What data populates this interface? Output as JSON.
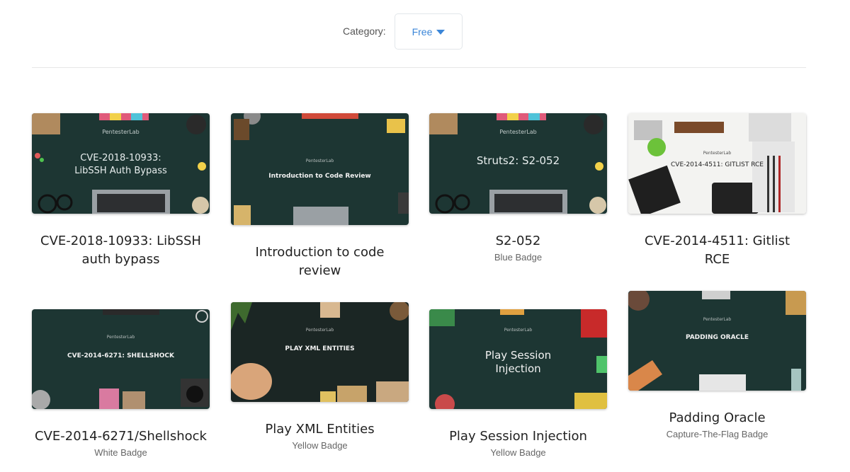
{
  "filter": {
    "label": "Category:",
    "selected": "Free"
  },
  "cards": [
    {
      "title": "CVE-2018-10933: LibSSH auth bypass",
      "badge": "",
      "brand": "PentesterLab",
      "thumb_lines": [
        "CVE-2018-10933:",
        "LibSSH Auth Bypass"
      ],
      "theme": "dark"
    },
    {
      "title": "Introduction to code review",
      "badge": "",
      "brand": "PentesterLab",
      "thumb_lines": [
        "Introduction to Code Review"
      ],
      "theme": "dark"
    },
    {
      "title": "S2-052",
      "badge": "Blue Badge",
      "brand": "PentesterLab",
      "thumb_lines": [
        "Struts2: S2-052"
      ],
      "theme": "dark"
    },
    {
      "title": "CVE-2014-4511: Gitlist RCE",
      "badge": "",
      "brand": "PentesterLab",
      "thumb_lines": [
        "CVE-2014-4511: GITLIST RCE"
      ],
      "theme": "light"
    },
    {
      "title": "CVE-2014-6271/Shellshock",
      "badge": "White Badge",
      "brand": "PentesterLab",
      "thumb_lines": [
        "CVE-2014-6271: SHELLSHOCK"
      ],
      "theme": "dark"
    },
    {
      "title": "Play XML Entities",
      "badge": "Yellow Badge",
      "brand": "PentesterLab",
      "thumb_lines": [
        "PLAY XML ENTITIES"
      ],
      "theme": "dark"
    },
    {
      "title": "Play Session Injection",
      "badge": "Yellow Badge",
      "brand": "PentesterLab",
      "thumb_lines": [
        "Play Session",
        "Injection"
      ],
      "theme": "dark"
    },
    {
      "title": "Padding Oracle",
      "badge": "Capture-The-Flag Badge",
      "brand": "PentesterLab",
      "thumb_lines": [
        "PADDING ORACLE"
      ],
      "theme": "dark"
    }
  ],
  "colors": {
    "accent": "#3b86d8",
    "dark_bg": "#1d3633",
    "light_bg": "#f3f3f1"
  }
}
